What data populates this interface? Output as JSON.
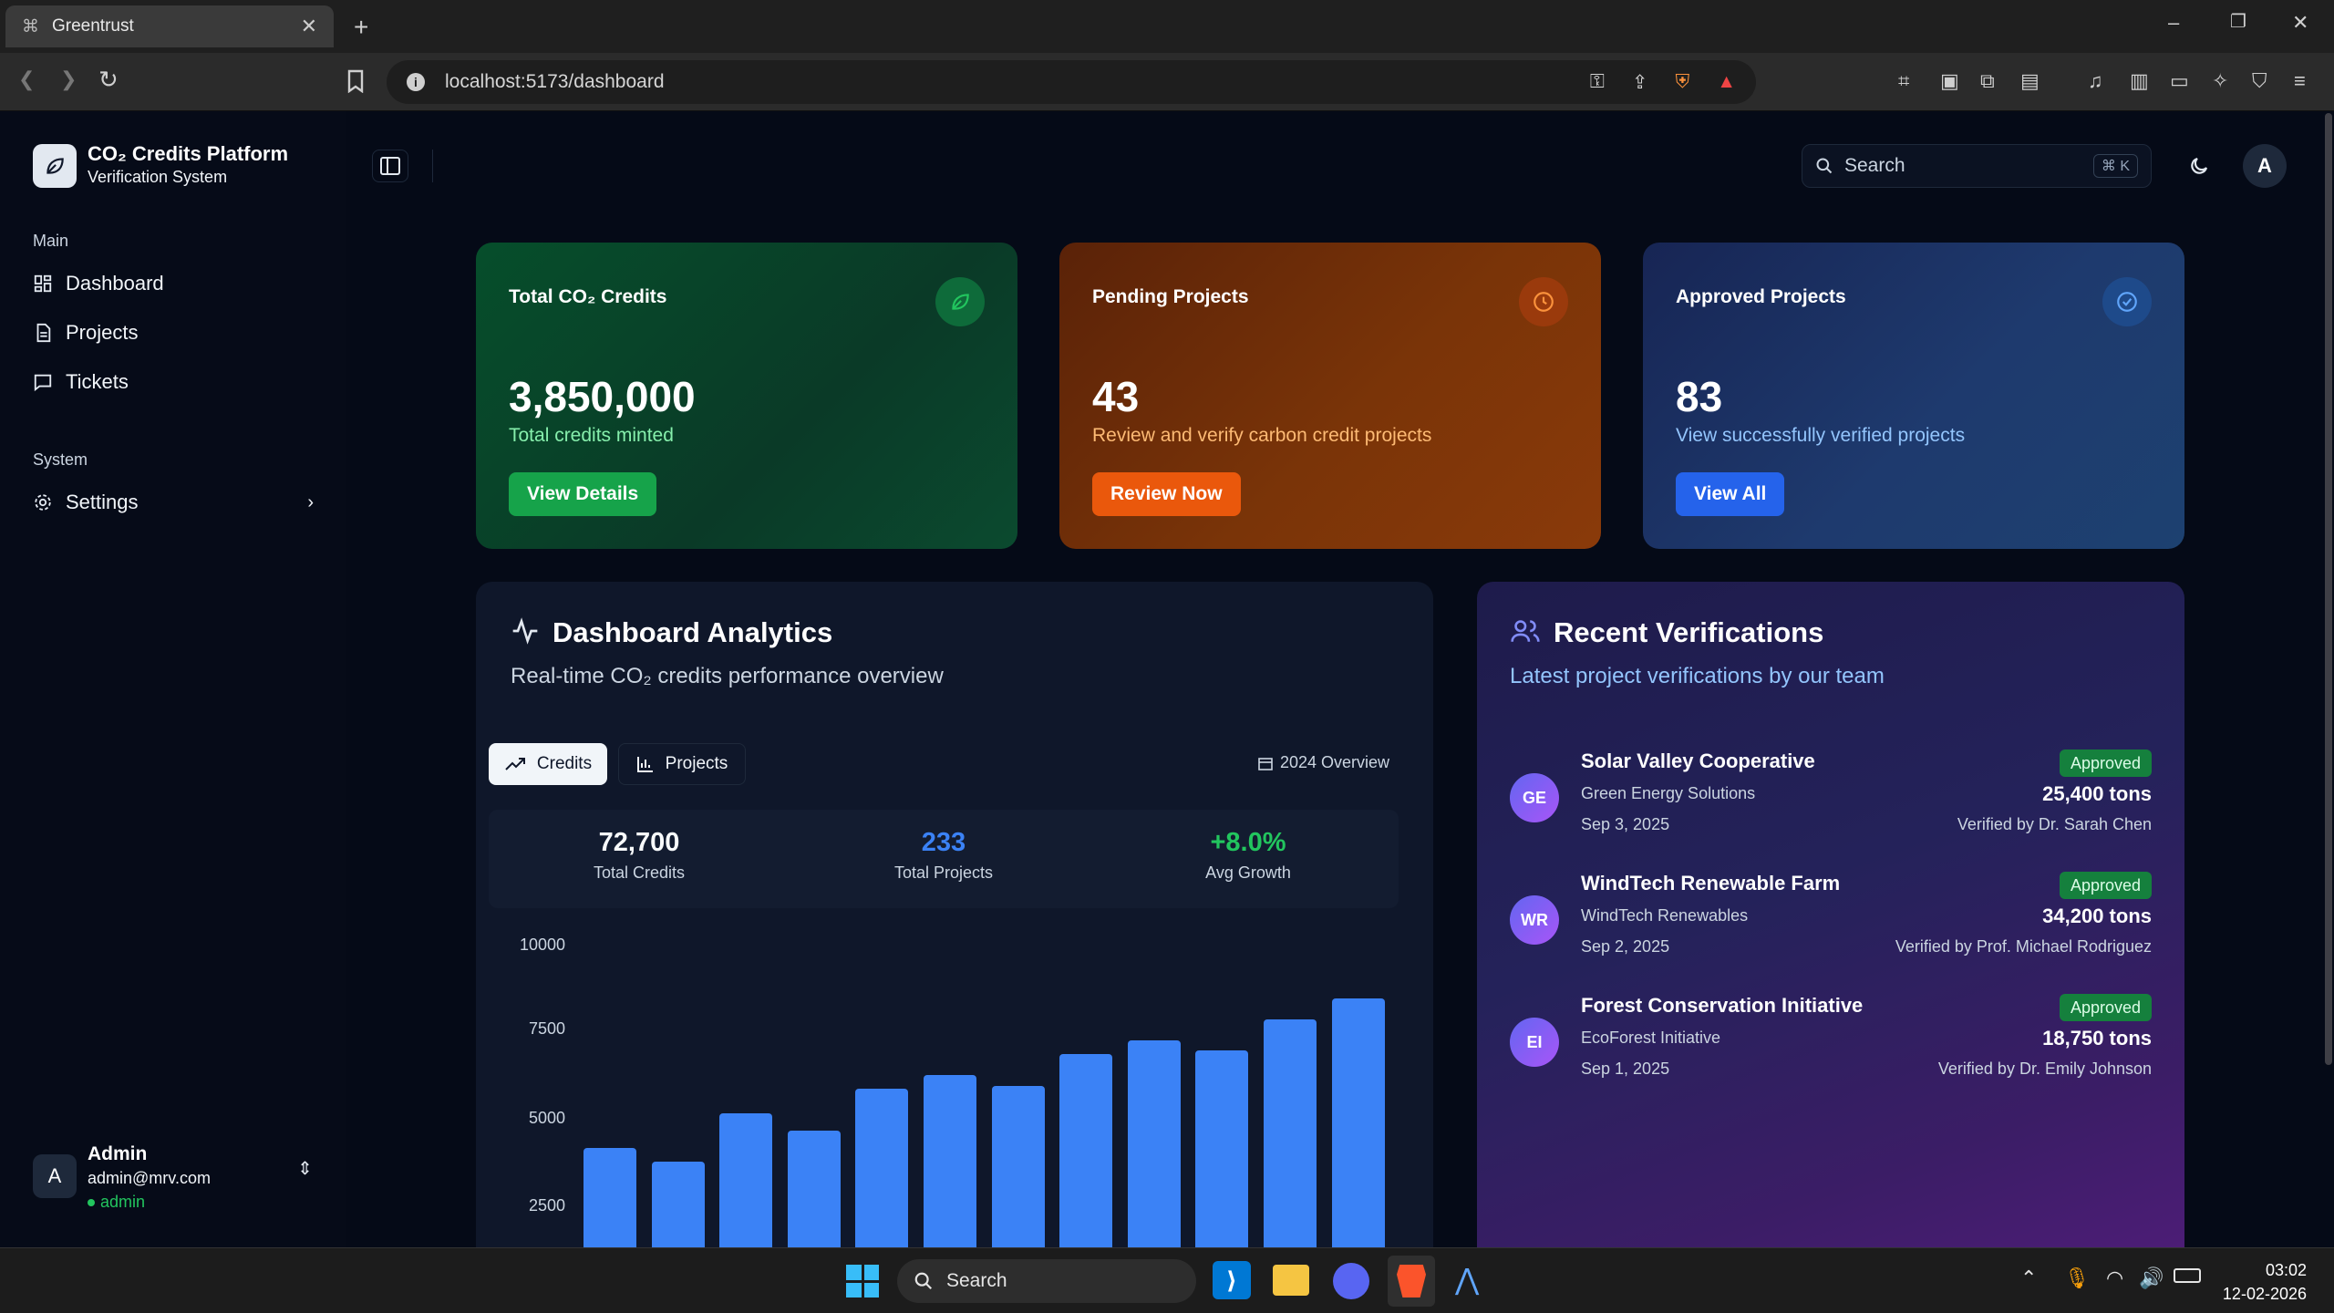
{
  "browser": {
    "tab_title": "Greentrust",
    "url": "localhost:5173/dashboard"
  },
  "sidebar": {
    "brand_title": "CO₂ Credits Platform",
    "brand_subtitle": "Verification System",
    "section_main": "Main",
    "section_system": "System",
    "items": [
      {
        "label": "Dashboard",
        "icon": "dashboard-icon"
      },
      {
        "label": "Projects",
        "icon": "document-icon"
      },
      {
        "label": "Tickets",
        "icon": "message-icon"
      }
    ],
    "settings_label": "Settings",
    "user": {
      "avatar": "A",
      "name": "Admin",
      "email": "admin@mrv.com",
      "role": "admin"
    }
  },
  "header": {
    "search_placeholder": "Search",
    "search_shortcut": "⌘ K",
    "avatar": "A"
  },
  "cards": [
    {
      "title": "Total CO₂ Credits",
      "value": "3,850,000",
      "subtitle": "Total credits minted",
      "button": "View Details",
      "color": "#16a34a"
    },
    {
      "title": "Pending Projects",
      "value": "43",
      "subtitle": "Review and verify carbon credit projects",
      "button": "Review Now",
      "color": "#ea580c"
    },
    {
      "title": "Approved Projects",
      "value": "83",
      "subtitle": "View successfully verified projects",
      "button": "View All",
      "color": "#2563eb"
    }
  ],
  "analytics": {
    "title": "Dashboard Analytics",
    "subtitle": "Real-time CO₂ credits performance overview",
    "tab_credits": "Credits",
    "tab_projects": "Projects",
    "overview": "2024 Overview",
    "stats": [
      {
        "value": "72,700",
        "label": "Total Credits",
        "color": "#f8fafc"
      },
      {
        "value": "233",
        "label": "Total Projects",
        "color": "#3b82f6"
      },
      {
        "value": "+8.0%",
        "label": "Avg Growth",
        "color": "#22c55e"
      }
    ]
  },
  "chart_data": {
    "type": "bar",
    "yticks": [
      "10000",
      "7500",
      "5000",
      "2500"
    ],
    "ylim": [
      0,
      10000
    ],
    "values": [
      4200,
      3800,
      5200,
      4700,
      5900,
      6300,
      6000,
      6900,
      7300,
      7000,
      7900,
      8500
    ],
    "color": "#3b82f6"
  },
  "verifications": {
    "title": "Recent Verifications",
    "subtitle": "Latest project verifications by our team",
    "items": [
      {
        "initials": "GE",
        "name": "Solar Valley Cooperative",
        "org": "Green Energy Solutions",
        "date": "Sep 3, 2025",
        "status": "Approved",
        "tons": "25,400 tons",
        "verified_by": "Verified by Dr. Sarah Chen"
      },
      {
        "initials": "WR",
        "name": "WindTech Renewable Farm",
        "org": "WindTech Renewables",
        "date": "Sep 2, 2025",
        "status": "Approved",
        "tons": "34,200 tons",
        "verified_by": "Verified by Prof. Michael Rodriguez"
      },
      {
        "initials": "EI",
        "name": "Forest Conservation Initiative",
        "org": "EcoForest Initiative",
        "date": "Sep 1, 2025",
        "status": "Approved",
        "tons": "18,750 tons",
        "verified_by": "Verified by Dr. Emily Johnson"
      }
    ]
  },
  "taskbar": {
    "search_placeholder": "Search",
    "time": "03:02",
    "date": "12-02-2026"
  }
}
